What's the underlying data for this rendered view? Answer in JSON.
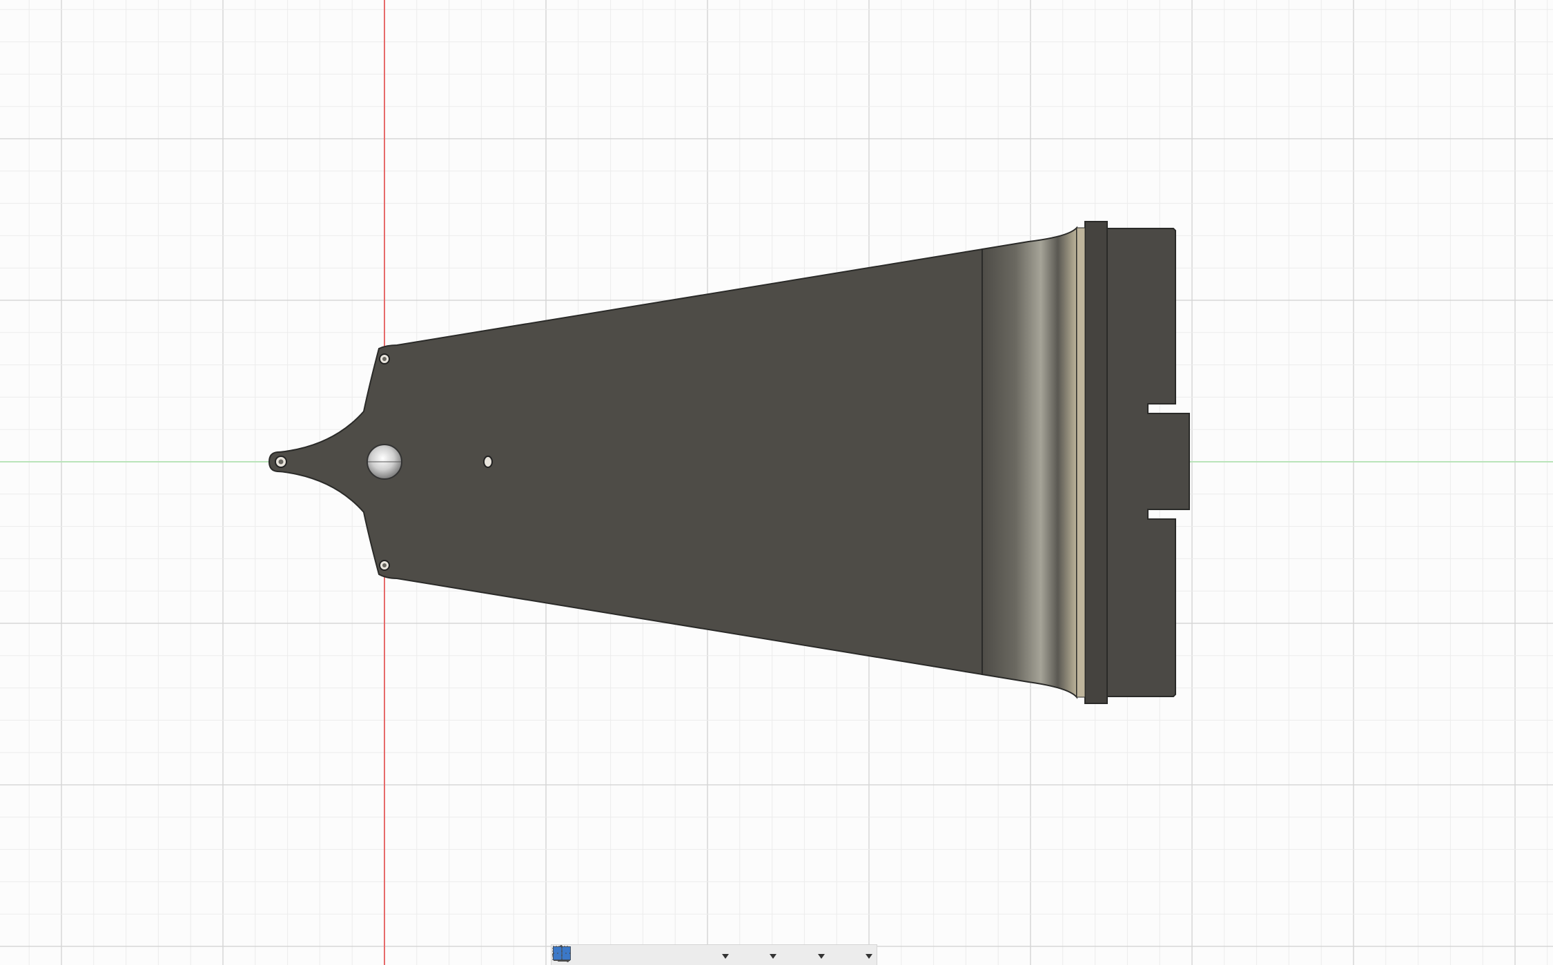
{
  "colors": {
    "background": "#fcfcfc",
    "grid_minor": "#ececec",
    "grid_major": "#d6d6d6",
    "axis_x": "#b9e3b9",
    "axis_y": "#e66a6a",
    "body": "#4e4c47",
    "body_outline": "#2a2a28",
    "toolbar": "#ececec",
    "icon": "#4a4a4a",
    "icon_accent": "#3b78c8"
  },
  "navbar": {
    "buttons": [
      {
        "icon": "orbit-icon",
        "has_menu": true
      },
      {
        "icon": "look-at-icon",
        "has_menu": false
      },
      {
        "icon": "pan-hand-icon",
        "has_menu": false
      },
      {
        "icon": "zoom-icon",
        "has_menu": false
      },
      {
        "icon": "zoom-window-icon",
        "has_menu": true
      },
      {
        "icon": "display-settings-icon",
        "has_menu": true
      },
      {
        "icon": "grid-snap-icon",
        "has_menu": true
      },
      {
        "icon": "viewports-icon",
        "has_menu": true
      }
    ]
  }
}
